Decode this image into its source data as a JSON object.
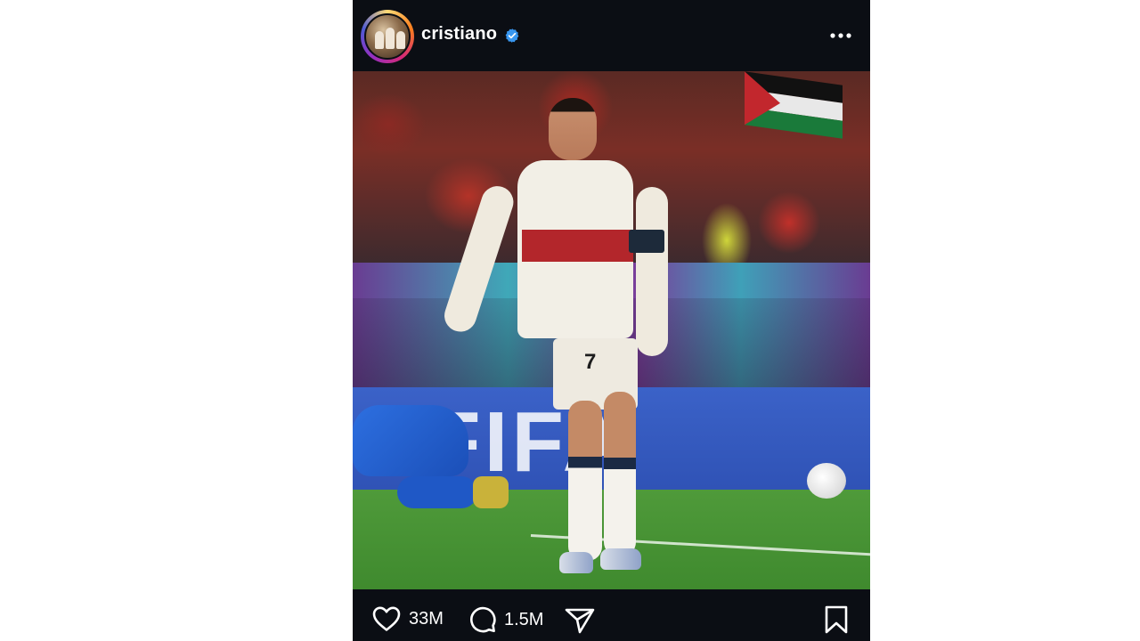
{
  "post": {
    "username": "cristiano",
    "verified": true,
    "avatar": "profile-photo",
    "image": {
      "description_icon": "photo",
      "board_text": "FIFA"
    },
    "actions": {
      "likes": "33M",
      "comments": "1.5M"
    },
    "icons": {
      "more": "more-horizontal-icon",
      "like": "heart-icon",
      "comment": "comment-icon",
      "share": "send-icon",
      "save": "bookmark-icon",
      "verified": "verified-badge-icon"
    },
    "colors": {
      "background": "#0b0e14",
      "verified_blue": "#3897f0",
      "text": "#ffffff"
    }
  }
}
